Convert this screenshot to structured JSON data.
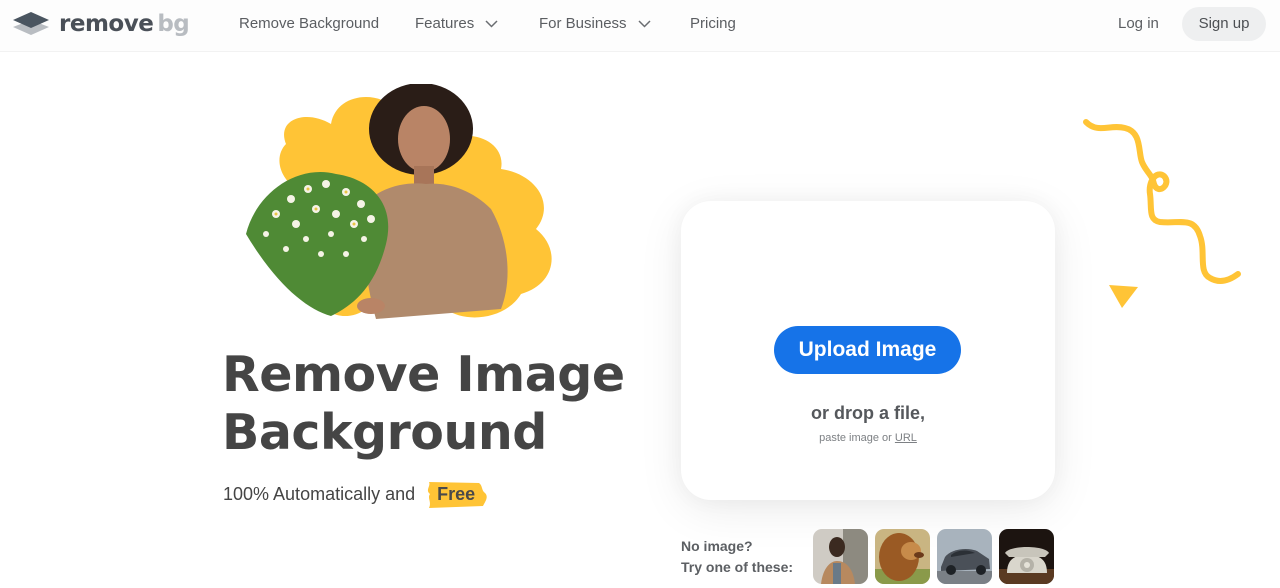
{
  "header": {
    "logo": {
      "brand_main": "remove",
      "brand_suffix": "bg",
      "icon": "layers-logo-icon"
    },
    "nav": [
      {
        "label": "Remove Background",
        "has_dropdown": false
      },
      {
        "label": "Features",
        "has_dropdown": true,
        "icon": "chevron-down-icon"
      },
      {
        "label": "For Business",
        "has_dropdown": true,
        "icon": "chevron-down-icon"
      },
      {
        "label": "Pricing",
        "has_dropdown": false
      }
    ],
    "login_label": "Log in",
    "signup_label": "Sign up"
  },
  "hero": {
    "image_description": "Woman with curly hair holding a bouquet of white wildflowers over a yellow blob shape",
    "headline_line1": "Remove Image",
    "headline_line2": "Background",
    "subline_text": "100% Automatically and",
    "subline_badge": "Free"
  },
  "upload": {
    "button_label": "Upload Image",
    "drop_text": "or drop a file,",
    "paste_text": "paste image or",
    "url_link": "URL"
  },
  "samples": {
    "prompt_line1": "No image?",
    "prompt_line2": "Try one of these:",
    "items": [
      {
        "subject": "person-on-phone"
      },
      {
        "subject": "lion"
      },
      {
        "subject": "car"
      },
      {
        "subject": "rotary-telephone"
      }
    ]
  },
  "colors": {
    "accent_blue": "#1673e8",
    "accent_yellow": "#ffc436",
    "text_dark": "#454545"
  }
}
